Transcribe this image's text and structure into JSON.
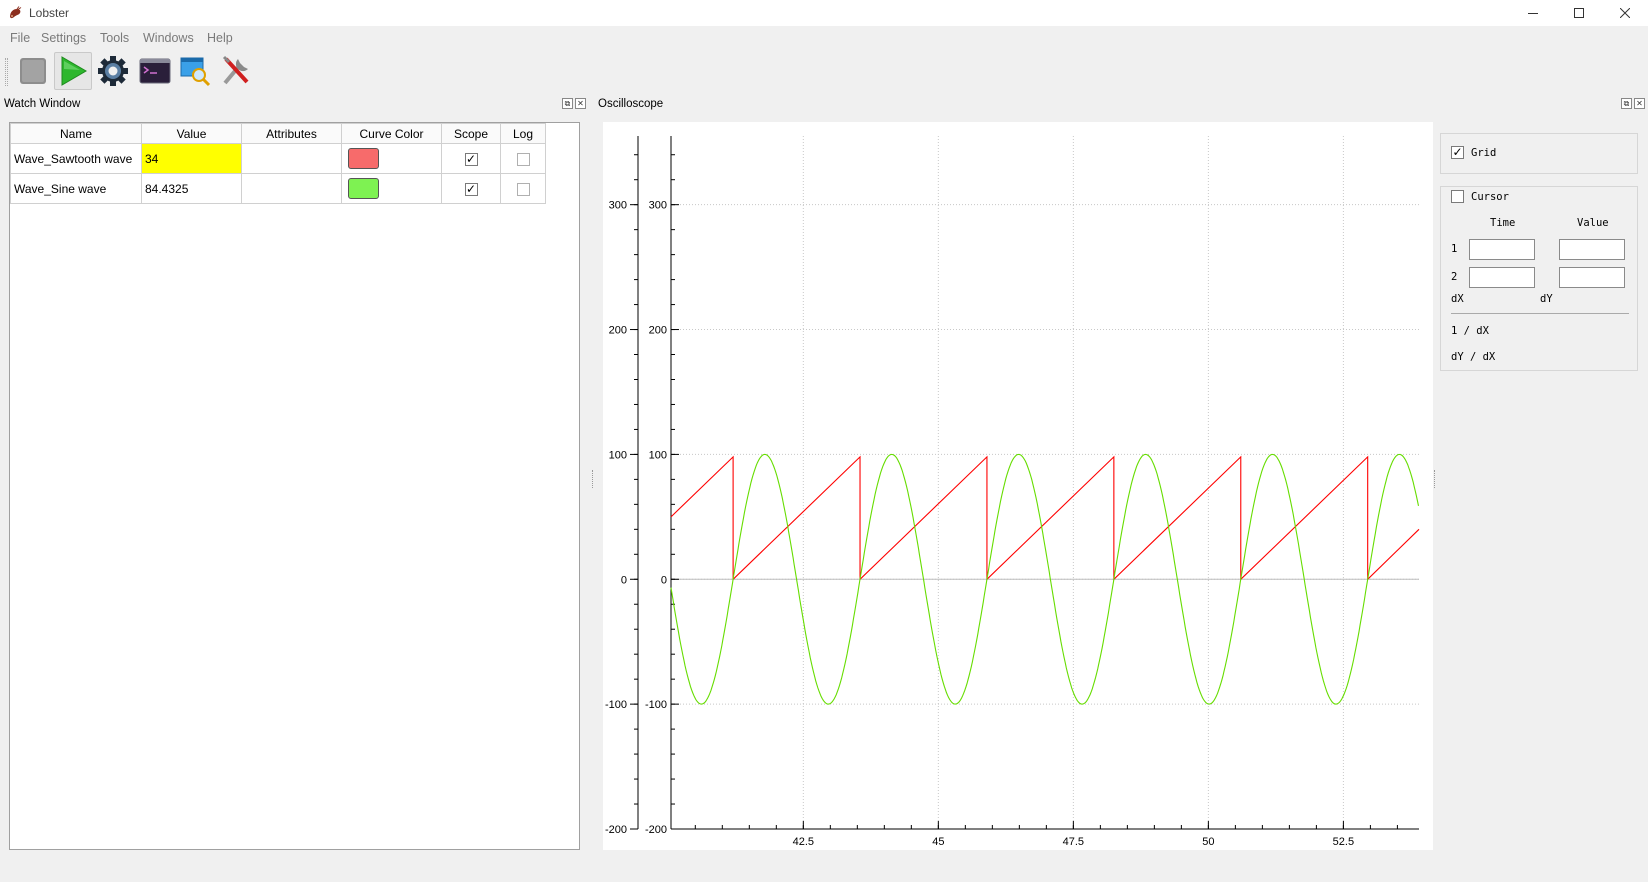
{
  "app": {
    "title": "Lobster"
  },
  "menu": [
    "File",
    "Settings",
    "Tools",
    "Windows",
    "Help"
  ],
  "toolbar": {
    "items": [
      "stop-icon",
      "run-icon",
      "gear-icon",
      "terminal-icon",
      "inspect-window-icon",
      "tools-icon"
    ]
  },
  "watch": {
    "title": "Watch Window",
    "columns": [
      "Name",
      "Value",
      "Attributes",
      "Curve Color",
      "Scope",
      "Log"
    ],
    "rows": [
      {
        "name": "Wave_Sawtooth wave",
        "value": "34",
        "attributes": "",
        "color": "#f76b6b",
        "scope": true,
        "log": false
      },
      {
        "name": "Wave_Sine wave",
        "value": "84.4325",
        "attributes": "",
        "color": "#7ef252",
        "scope": true,
        "log": false
      }
    ]
  },
  "scope": {
    "title": "Oscilloscope"
  },
  "controls": {
    "grid_label": "Grid",
    "grid_checked": true,
    "cursor_label": "Cursor",
    "cursor_checked": false,
    "time_header": "Time",
    "value_header": "Value",
    "row1": "1",
    "row2": "2",
    "dx": "dX",
    "dy": "dY",
    "inv_dx": "1  / dX",
    "dy_dx": "dY / dX"
  },
  "chart_data": {
    "type": "line",
    "title": "",
    "xlabel": "",
    "ylabel": "",
    "xlim": [
      40.05,
      53.9
    ],
    "ylim": [
      -200,
      355
    ],
    "xticks": [
      42.5,
      45,
      47.5,
      50,
      52.5
    ],
    "yticks": [
      -200,
      -100,
      0,
      100,
      200,
      300
    ],
    "grid": true,
    "series": [
      {
        "color": "#ff0000",
        "x": [
          40.05,
          41.2,
          41.2,
          43.55,
          43.55,
          45.9,
          45.9,
          48.25,
          48.25,
          50.6,
          50.6,
          52.95,
          52.95,
          53.9
        ],
        "y": [
          50,
          98,
          0,
          98,
          0,
          98,
          0,
          98,
          0,
          98,
          0,
          98,
          0,
          40
        ]
      },
      {
        "color": "#66dd00",
        "period": 2.35,
        "amplitude": 100,
        "first_zero_crossing": 41.2,
        "peaks": [
          {
            "x": 41.79,
            "y": 100
          },
          {
            "x": 44.14,
            "y": 100
          },
          {
            "x": 46.49,
            "y": 100
          },
          {
            "x": 48.84,
            "y": 100
          },
          {
            "x": 51.19,
            "y": 100
          },
          {
            "x": 53.54,
            "y": 100
          }
        ],
        "troughs": [
          {
            "x": 40.61,
            "y": -100
          },
          {
            "x": 42.96,
            "y": -100
          },
          {
            "x": 45.31,
            "y": -100
          },
          {
            "x": 47.66,
            "y": -100
          },
          {
            "x": 50.01,
            "y": -100
          },
          {
            "x": 52.36,
            "y": -100
          }
        ]
      }
    ]
  }
}
